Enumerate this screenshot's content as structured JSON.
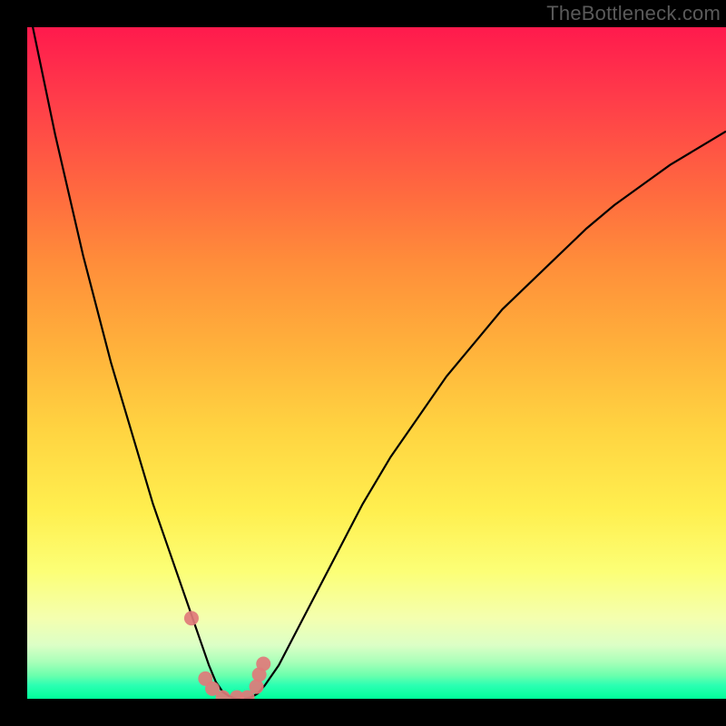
{
  "watermark": "TheBottleneck.com",
  "colors": {
    "frame": "#000000",
    "curve_stroke": "#000000",
    "marker_fill": "#e07a7a",
    "gradient_stops": [
      "#ff1a4d",
      "#ff3a4a",
      "#ff6b3f",
      "#ff8d3a",
      "#ffb23b",
      "#ffd441",
      "#ffef4f",
      "#fcff76",
      "#f4ffaf",
      "#dcffc6",
      "#a9ffb9",
      "#6cffad",
      "#2bffb2",
      "#00ff9a"
    ]
  },
  "chart_data": {
    "type": "line",
    "title": "",
    "xlabel": "",
    "ylabel": "",
    "xlim": [
      0,
      100
    ],
    "ylim": [
      0,
      100
    ],
    "x": [
      0,
      2,
      4,
      6,
      8,
      10,
      12,
      14,
      16,
      18,
      20,
      22,
      23,
      24,
      25,
      26,
      27,
      28,
      29,
      30,
      31,
      32,
      33,
      34,
      36,
      38,
      40,
      44,
      48,
      52,
      56,
      60,
      64,
      68,
      72,
      76,
      80,
      84,
      88,
      92,
      96,
      100
    ],
    "y": [
      104,
      94,
      84,
      75,
      66,
      58,
      50,
      43,
      36,
      29,
      23,
      17,
      14,
      11,
      8,
      5,
      2.5,
      1,
      0.3,
      0,
      0,
      0.2,
      0.8,
      2,
      5,
      9,
      13,
      21,
      29,
      36,
      42,
      48,
      53,
      58,
      62,
      66,
      70,
      73.5,
      76.5,
      79.5,
      82,
      84.5
    ],
    "markers": [
      {
        "x": 23.5,
        "y": 12
      },
      {
        "x": 25.5,
        "y": 3
      },
      {
        "x": 26.5,
        "y": 1.5
      },
      {
        "x": 28,
        "y": 0.2
      },
      {
        "x": 30,
        "y": 0.2
      },
      {
        "x": 31.5,
        "y": 0.2
      },
      {
        "x": 32.8,
        "y": 1.8
      },
      {
        "x": 33.2,
        "y": 3.6
      },
      {
        "x": 33.8,
        "y": 5.2
      }
    ]
  }
}
